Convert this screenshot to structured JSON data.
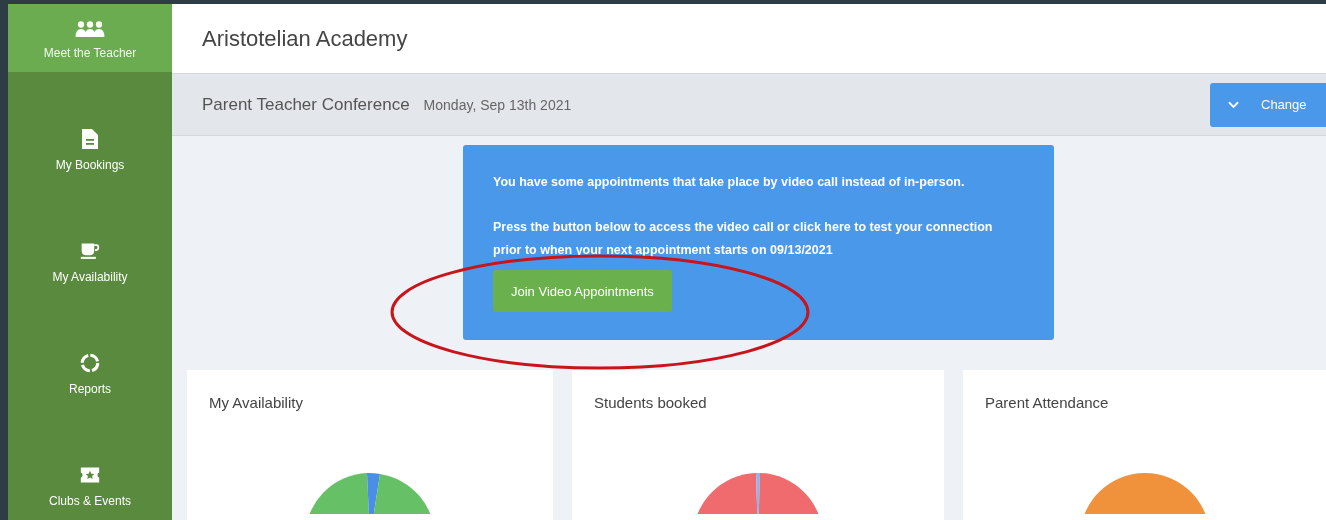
{
  "sidebar": {
    "items": [
      {
        "label": "Meet the Teacher",
        "kind": "people",
        "selected": true
      },
      {
        "label": "My Bookings",
        "kind": "document",
        "selected": false
      },
      {
        "label": "My Availability",
        "kind": "cup",
        "selected": false
      },
      {
        "label": "Reports",
        "kind": "ring",
        "selected": false
      },
      {
        "label": "Clubs & Events",
        "kind": "ticket",
        "selected": false
      }
    ]
  },
  "header": {
    "title": "Aristotelian Academy"
  },
  "event_bar": {
    "title": "Parent Teacher Conference",
    "date": "Monday, Sep 13th 2021",
    "change_button": "Change"
  },
  "notice": {
    "lines": [
      "You have some appointments that take place by video call instead of in-person.",
      "Press the button below to access the video call or click here to test your connection prior to when your next appointment starts on 09/13/2021"
    ],
    "button": "Join Video Appointments"
  },
  "cards": [
    {
      "title": "My Availability",
      "kind": "availability"
    },
    {
      "title": "Students booked",
      "kind": "booked"
    },
    {
      "title": "Parent Attendance",
      "kind": "attendance"
    }
  ],
  "annotations": [
    {
      "kind": "ellipse"
    }
  ]
}
